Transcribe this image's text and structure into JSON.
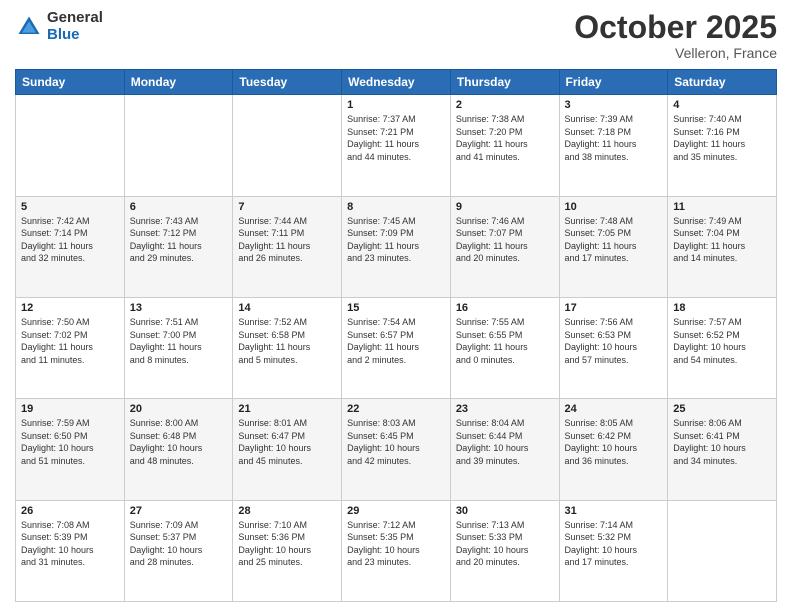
{
  "logo": {
    "general": "General",
    "blue": "Blue"
  },
  "title": {
    "month": "October 2025",
    "location": "Velleron, France"
  },
  "days_of_week": [
    "Sunday",
    "Monday",
    "Tuesday",
    "Wednesday",
    "Thursday",
    "Friday",
    "Saturday"
  ],
  "weeks": [
    [
      {
        "day": "",
        "info": ""
      },
      {
        "day": "",
        "info": ""
      },
      {
        "day": "",
        "info": ""
      },
      {
        "day": "1",
        "info": "Sunrise: 7:37 AM\nSunset: 7:21 PM\nDaylight: 11 hours\nand 44 minutes."
      },
      {
        "day": "2",
        "info": "Sunrise: 7:38 AM\nSunset: 7:20 PM\nDaylight: 11 hours\nand 41 minutes."
      },
      {
        "day": "3",
        "info": "Sunrise: 7:39 AM\nSunset: 7:18 PM\nDaylight: 11 hours\nand 38 minutes."
      },
      {
        "day": "4",
        "info": "Sunrise: 7:40 AM\nSunset: 7:16 PM\nDaylight: 11 hours\nand 35 minutes."
      }
    ],
    [
      {
        "day": "5",
        "info": "Sunrise: 7:42 AM\nSunset: 7:14 PM\nDaylight: 11 hours\nand 32 minutes."
      },
      {
        "day": "6",
        "info": "Sunrise: 7:43 AM\nSunset: 7:12 PM\nDaylight: 11 hours\nand 29 minutes."
      },
      {
        "day": "7",
        "info": "Sunrise: 7:44 AM\nSunset: 7:11 PM\nDaylight: 11 hours\nand 26 minutes."
      },
      {
        "day": "8",
        "info": "Sunrise: 7:45 AM\nSunset: 7:09 PM\nDaylight: 11 hours\nand 23 minutes."
      },
      {
        "day": "9",
        "info": "Sunrise: 7:46 AM\nSunset: 7:07 PM\nDaylight: 11 hours\nand 20 minutes."
      },
      {
        "day": "10",
        "info": "Sunrise: 7:48 AM\nSunset: 7:05 PM\nDaylight: 11 hours\nand 17 minutes."
      },
      {
        "day": "11",
        "info": "Sunrise: 7:49 AM\nSunset: 7:04 PM\nDaylight: 11 hours\nand 14 minutes."
      }
    ],
    [
      {
        "day": "12",
        "info": "Sunrise: 7:50 AM\nSunset: 7:02 PM\nDaylight: 11 hours\nand 11 minutes."
      },
      {
        "day": "13",
        "info": "Sunrise: 7:51 AM\nSunset: 7:00 PM\nDaylight: 11 hours\nand 8 minutes."
      },
      {
        "day": "14",
        "info": "Sunrise: 7:52 AM\nSunset: 6:58 PM\nDaylight: 11 hours\nand 5 minutes."
      },
      {
        "day": "15",
        "info": "Sunrise: 7:54 AM\nSunset: 6:57 PM\nDaylight: 11 hours\nand 2 minutes."
      },
      {
        "day": "16",
        "info": "Sunrise: 7:55 AM\nSunset: 6:55 PM\nDaylight: 11 hours\nand 0 minutes."
      },
      {
        "day": "17",
        "info": "Sunrise: 7:56 AM\nSunset: 6:53 PM\nDaylight: 10 hours\nand 57 minutes."
      },
      {
        "day": "18",
        "info": "Sunrise: 7:57 AM\nSunset: 6:52 PM\nDaylight: 10 hours\nand 54 minutes."
      }
    ],
    [
      {
        "day": "19",
        "info": "Sunrise: 7:59 AM\nSunset: 6:50 PM\nDaylight: 10 hours\nand 51 minutes."
      },
      {
        "day": "20",
        "info": "Sunrise: 8:00 AM\nSunset: 6:48 PM\nDaylight: 10 hours\nand 48 minutes."
      },
      {
        "day": "21",
        "info": "Sunrise: 8:01 AM\nSunset: 6:47 PM\nDaylight: 10 hours\nand 45 minutes."
      },
      {
        "day": "22",
        "info": "Sunrise: 8:03 AM\nSunset: 6:45 PM\nDaylight: 10 hours\nand 42 minutes."
      },
      {
        "day": "23",
        "info": "Sunrise: 8:04 AM\nSunset: 6:44 PM\nDaylight: 10 hours\nand 39 minutes."
      },
      {
        "day": "24",
        "info": "Sunrise: 8:05 AM\nSunset: 6:42 PM\nDaylight: 10 hours\nand 36 minutes."
      },
      {
        "day": "25",
        "info": "Sunrise: 8:06 AM\nSunset: 6:41 PM\nDaylight: 10 hours\nand 34 minutes."
      }
    ],
    [
      {
        "day": "26",
        "info": "Sunrise: 7:08 AM\nSunset: 5:39 PM\nDaylight: 10 hours\nand 31 minutes."
      },
      {
        "day": "27",
        "info": "Sunrise: 7:09 AM\nSunset: 5:37 PM\nDaylight: 10 hours\nand 28 minutes."
      },
      {
        "day": "28",
        "info": "Sunrise: 7:10 AM\nSunset: 5:36 PM\nDaylight: 10 hours\nand 25 minutes."
      },
      {
        "day": "29",
        "info": "Sunrise: 7:12 AM\nSunset: 5:35 PM\nDaylight: 10 hours\nand 23 minutes."
      },
      {
        "day": "30",
        "info": "Sunrise: 7:13 AM\nSunset: 5:33 PM\nDaylight: 10 hours\nand 20 minutes."
      },
      {
        "day": "31",
        "info": "Sunrise: 7:14 AM\nSunset: 5:32 PM\nDaylight: 10 hours\nand 17 minutes."
      },
      {
        "day": "",
        "info": ""
      }
    ]
  ]
}
